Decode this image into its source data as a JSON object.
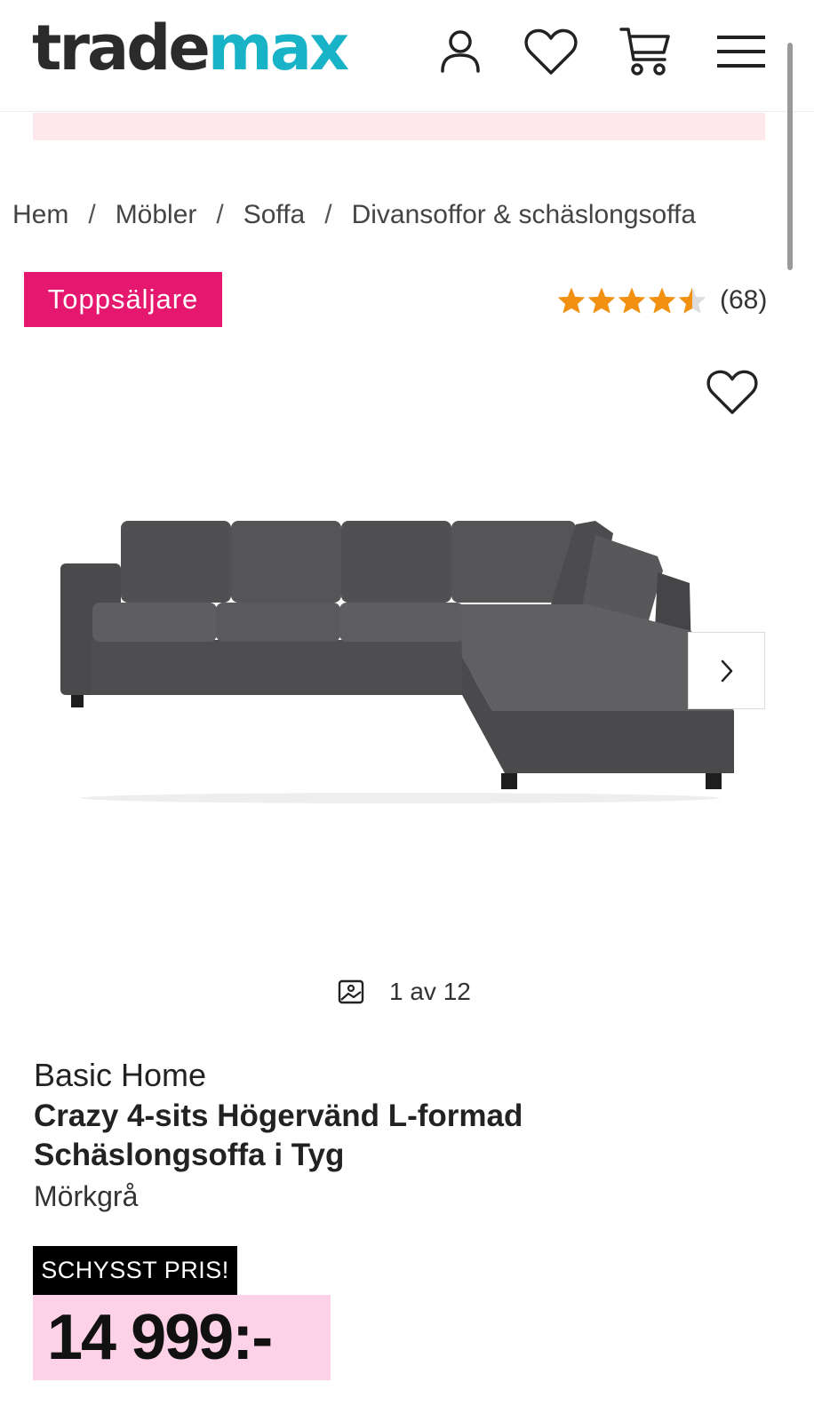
{
  "header": {
    "logo_part1": "trade",
    "logo_part2": "max",
    "icons": [
      "account-icon",
      "heart-icon",
      "cart-icon",
      "menu-icon"
    ]
  },
  "breadcrumb": [
    {
      "label": "Hem"
    },
    {
      "label": "Möbler"
    },
    {
      "label": "Soffa"
    },
    {
      "label": "Divansoffor & schäslongsoffa"
    }
  ],
  "breadcrumb_separator": "/",
  "badge": "Toppsäljare",
  "rating": {
    "value": 4.5,
    "max": 5,
    "count_text": "(68)"
  },
  "gallery": {
    "counter": "1 av 12"
  },
  "product": {
    "brand": "Basic Home",
    "title": "Crazy 4-sits Högervänd L-formad Schäslongsoffa i Tyg",
    "color": "Mörkgrå",
    "price_tag": "SCHYSST PRIS!",
    "price": "14 999:-"
  },
  "colors": {
    "logo_dark": "#2b2b2b",
    "logo_accent": "#19b3c8",
    "badge_bg": "#e5176e",
    "star": "#f29111",
    "price_bg": "#fdd2e7",
    "banner_bg": "#fde8ec"
  }
}
